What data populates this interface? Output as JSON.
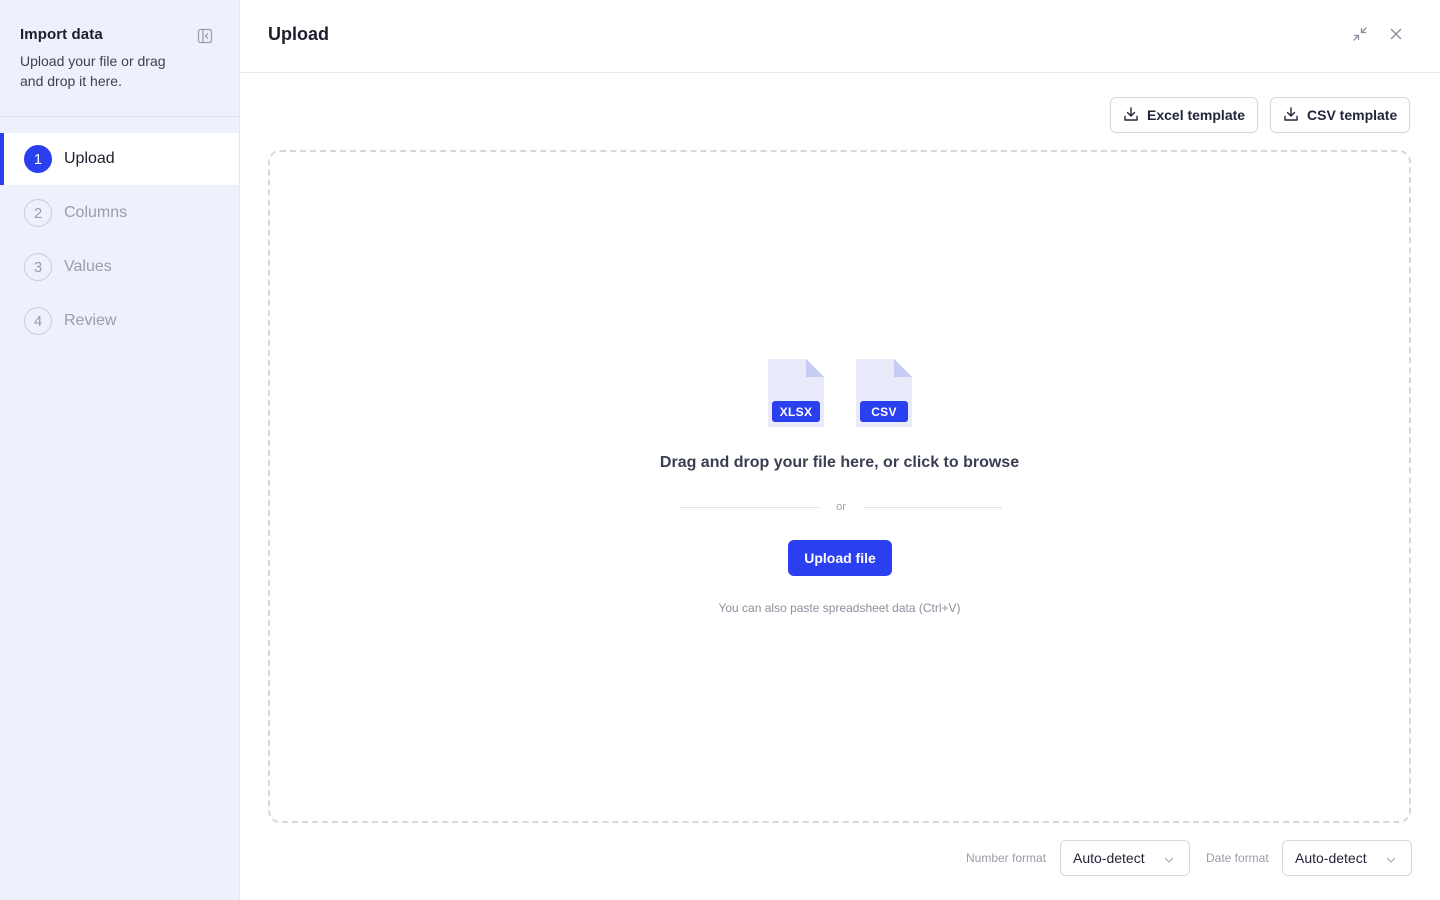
{
  "sidebar": {
    "title": "Import data",
    "subtitle": "Upload your file or drag and drop it here.",
    "steps": [
      {
        "num": "1",
        "label": "Upload",
        "active": true
      },
      {
        "num": "2",
        "label": "Columns",
        "active": false
      },
      {
        "num": "3",
        "label": "Values",
        "active": false
      },
      {
        "num": "4",
        "label": "Review",
        "active": false
      }
    ]
  },
  "header": {
    "title": "Upload"
  },
  "templates": {
    "excel_label": "Excel template",
    "csv_label": "CSV template"
  },
  "dropzone": {
    "file_types": [
      "XLSX",
      "CSV"
    ],
    "title": "Drag and drop your file here, or click to browse",
    "or_text": "or",
    "upload_label": "Upload file",
    "paste_hint": "You can also paste spreadsheet data (Ctrl+V)"
  },
  "formats": {
    "number_label": "Number format",
    "number_value": "Auto-detect",
    "date_label": "Date format",
    "date_value": "Auto-detect"
  },
  "colors": {
    "accent": "#2a3ff0",
    "sidebar_bg": "#eef0fb"
  }
}
